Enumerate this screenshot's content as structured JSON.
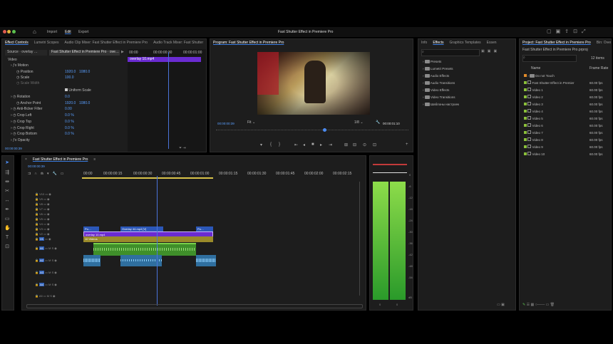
{
  "app": {
    "nav": {
      "import": "Import",
      "edit": "Edit",
      "export": "Export"
    },
    "title": "Fast Shutter Effect in Premiere Pro"
  },
  "effect_controls": {
    "tabs": [
      "Effect Controls",
      "Lumetri Scopes",
      "Audio Clip Mixer: Fast Shutter Effect in Premiere Pro",
      "Audio Track Mixer: Fast Shutter"
    ],
    "source": "Source · overlay …",
    "clip": "Fast Shutter Effect in Premiere Pro · ove…",
    "ruler": [
      "00:00",
      "00:00:00:30",
      "00:00:01:00"
    ],
    "clip_bar": "overlay 10.mp4",
    "section": "Video",
    "motion": "Motion",
    "rows": [
      {
        "name": "Position",
        "v1": "1920.0",
        "v2": "1080.0"
      },
      {
        "name": "Scale",
        "v1": "100.0",
        "v2": ""
      },
      {
        "name": "Scale Width",
        "v1": "",
        "v2": ""
      },
      {
        "name": "Uniform Scale",
        "v1": "",
        "v2": ""
      },
      {
        "name": "Rotation",
        "v1": "0.0",
        "v2": ""
      },
      {
        "name": "Anchor Point",
        "v1": "1920.0",
        "v2": "1080.0"
      },
      {
        "name": "Anti-flicker Filter",
        "v1": "0.00",
        "v2": ""
      },
      {
        "name": "Crop Left",
        "v1": "0.0 %",
        "v2": ""
      },
      {
        "name": "Crop Top",
        "v1": "0.0 %",
        "v2": ""
      },
      {
        "name": "Crop Right",
        "v1": "0.0 %",
        "v2": ""
      },
      {
        "name": "Crop Bottom",
        "v1": "0.0 %",
        "v2": ""
      },
      {
        "name": "Opacity",
        "v1": "",
        "v2": ""
      }
    ],
    "timecode": "00:00:00:39"
  },
  "program": {
    "title": "Program: Fast Shutter Effect in Premiere Pro",
    "timecode": "00:00:00:39",
    "fit": "Fit",
    "resolution": "1/8",
    "duration": "00:00:01:10"
  },
  "effects": {
    "tabs": [
      "Info",
      "Effects",
      "Graphics Templates",
      "Essen"
    ],
    "items": [
      "Presets",
      "Lumetri Presets",
      "Audio Effects",
      "Audio Transitions",
      "Video Effects",
      "Video Transitions",
      "Шаблоны настроек"
    ]
  },
  "project": {
    "tabs": [
      "Project: Fast Shutter Effect in Premiere Pro",
      "Bin: Over"
    ],
    "file": "Fast Shutter Effect in Premiere Pro.prproj",
    "count": "12 items",
    "col_name": "Name",
    "col_rate": "Frame Rate",
    "items": [
      {
        "name": "Do not Touch",
        "rate": ""
      },
      {
        "name": "Fast Shutter Effect in Premier",
        "rate": "60.00 fps"
      },
      {
        "name": "Video 1",
        "rate": "60.00 fps"
      },
      {
        "name": "Video 2",
        "rate": "60.00 fps"
      },
      {
        "name": "Video 3",
        "rate": "60.00 fps"
      },
      {
        "name": "Video 4",
        "rate": "60.00 fps"
      },
      {
        "name": "Video 5",
        "rate": "60.00 fps"
      },
      {
        "name": "Video 6",
        "rate": "60.00 fps"
      },
      {
        "name": "Video 7",
        "rate": "60.00 fps"
      },
      {
        "name": "Video 8",
        "rate": "60.00 fps"
      },
      {
        "name": "Video 9",
        "rate": "60.00 fps"
      },
      {
        "name": "Video 10",
        "rate": "60.00 fps"
      }
    ]
  },
  "timeline": {
    "title": "Fast Shutter Effect in Premiere Pro",
    "timecode": "00:00:00:39",
    "ruler": [
      "00:00",
      "00:00:00:15",
      "00:00:00:30",
      "00:00:00:45",
      "00:00:01:00",
      "00:00:01:15",
      "00:00:01:30",
      "00:00:01:45",
      "00:00:02:00",
      "00:00:02:15"
    ],
    "video_tracks": [
      "V10",
      "V9",
      "V8",
      "V7",
      "V6",
      "V5",
      "V4",
      "V3",
      "V2",
      "V1"
    ],
    "audio_tracks": [
      "A1",
      "A2",
      "A3",
      "A4",
      "A5"
    ],
    "clips": {
      "v3_a": "Po…",
      "v3_b": "Overlay 44.mp4 [V]",
      "v3_c": "Po…",
      "v2": "overlay 10.mp4",
      "v1": "10 Videos"
    }
  },
  "meter": {
    "scale": [
      "0",
      "-6",
      "-12",
      "-18",
      "-24",
      "-30",
      "-36",
      "-42",
      "-48",
      "-54",
      "dB"
    ],
    "bottom": [
      "0",
      "0"
    ],
    "level": 0.78
  }
}
